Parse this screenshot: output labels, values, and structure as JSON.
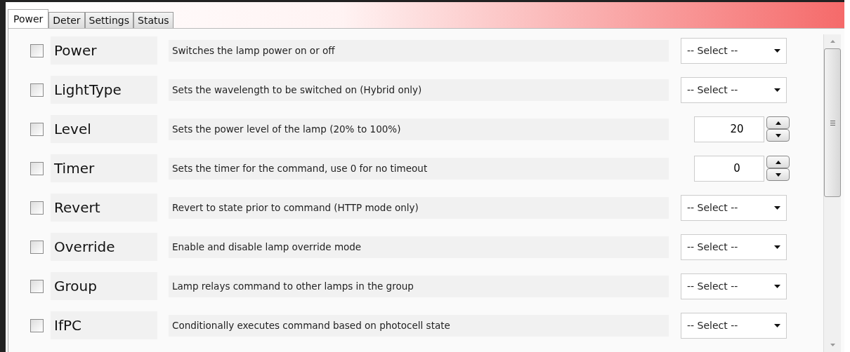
{
  "tabs": [
    {
      "label": "Power",
      "selected": true
    },
    {
      "label": "Deter",
      "selected": false
    },
    {
      "label": "Settings",
      "selected": false
    },
    {
      "label": "Status",
      "selected": false
    }
  ],
  "commands": [
    {
      "name": "Power",
      "checked": false,
      "description": "Switches the lamp power on or off",
      "kind": "select",
      "value": "-- Select --"
    },
    {
      "name": "LightType",
      "checked": false,
      "description": "Sets the wavelength to be switched on (Hybrid only)",
      "kind": "select",
      "value": "-- Select --"
    },
    {
      "name": "Level",
      "checked": false,
      "description": "Sets the power level of the lamp (20% to 100%)",
      "kind": "spinner",
      "value": "20"
    },
    {
      "name": "Timer",
      "checked": false,
      "description": "Sets the timer for the command, use 0 for no timeout",
      "kind": "spinner",
      "value": "0"
    },
    {
      "name": "Revert",
      "checked": false,
      "description": "Revert to state prior to command (HTTP mode only)",
      "kind": "select",
      "value": "-- Select --"
    },
    {
      "name": "Override",
      "checked": false,
      "description": "Enable and disable lamp override mode",
      "kind": "select",
      "value": "-- Select --"
    },
    {
      "name": "Group",
      "checked": false,
      "description": "Lamp relays command to other lamps in the group",
      "kind": "select",
      "value": "-- Select --"
    },
    {
      "name": "IfPC",
      "checked": false,
      "description": "Conditionally executes command based on photocell state",
      "kind": "select",
      "value": "-- Select --"
    }
  ]
}
